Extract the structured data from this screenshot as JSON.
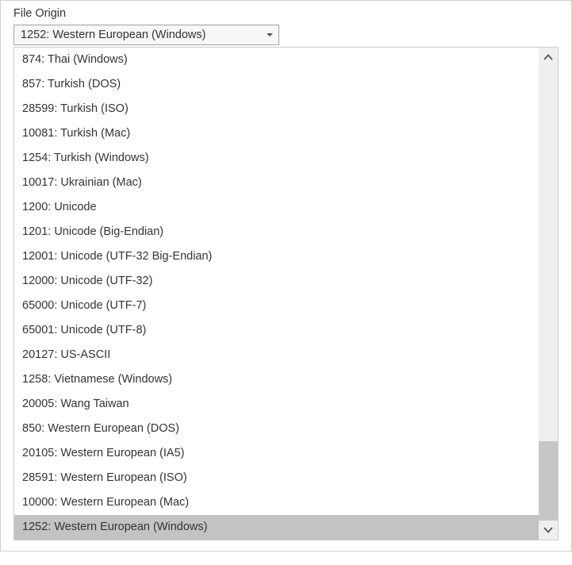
{
  "label": "File Origin",
  "selected": "1252: Western European (Windows)",
  "options": [
    "874: Thai (Windows)",
    "857: Turkish (DOS)",
    "28599: Turkish (ISO)",
    "10081: Turkish (Mac)",
    "1254: Turkish (Windows)",
    "10017: Ukrainian (Mac)",
    "1200: Unicode",
    "1201: Unicode (Big-Endian)",
    "12001: Unicode (UTF-32 Big-Endian)",
    "12000: Unicode (UTF-32)",
    "65000: Unicode (UTF-7)",
    "65001: Unicode (UTF-8)",
    "20127: US-ASCII",
    "1258: Vietnamese (Windows)",
    "20005: Wang Taiwan",
    "850: Western European (DOS)",
    "20105: Western European (IA5)",
    "28591: Western European (ISO)",
    "10000: Western European (Mac)",
    "1252: Western European (Windows)"
  ],
  "selectedIndex": 19
}
